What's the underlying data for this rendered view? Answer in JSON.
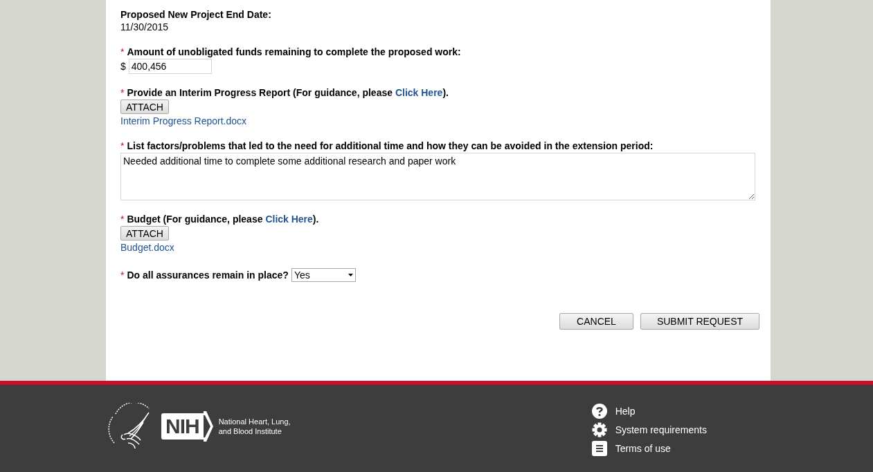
{
  "fields": [
    {
      "kind": "static",
      "required": false,
      "label": "Proposed New Project End Date:",
      "value": "11/30/2015"
    },
    {
      "kind": "currency",
      "required": true,
      "label": "Amount of unobligated funds remaining to complete the proposed work:",
      "prefix": "$",
      "value": "400,456"
    },
    {
      "kind": "attachment",
      "required": true,
      "label_before": "Provide an Interim Progress Report (For guidance, please ",
      "link": "Click Here",
      "label_after": ").",
      "button": "ATTACH",
      "file": "Interim Progress Report.docx"
    },
    {
      "kind": "textarea",
      "required": true,
      "label": "List factors/problems that led to the need for additional time and how they can be avoided in the extension period:",
      "value": "Needed additional time to complete some additional research and paper work"
    },
    {
      "kind": "attachment",
      "required": true,
      "label_before": "Budget (For guidance, please ",
      "link": "Click Here",
      "label_after": ").",
      "button": "ATTACH",
      "file": "Budget.docx"
    },
    {
      "kind": "select",
      "required": true,
      "label": "Do all assurances remain in place?",
      "value": "Yes"
    }
  ],
  "required_marker": "*",
  "actions": [
    "CANCEL",
    "SUBMIT REQUEST"
  ],
  "footer": {
    "nih_badge": "NIH",
    "institute": [
      "National Heart, Lung,",
      "and Blood Institute"
    ],
    "links": [
      {
        "kind": "help",
        "label": "Help"
      },
      {
        "kind": "settings",
        "label": "System requirements"
      },
      {
        "kind": "document",
        "label": "Terms of use"
      }
    ]
  }
}
